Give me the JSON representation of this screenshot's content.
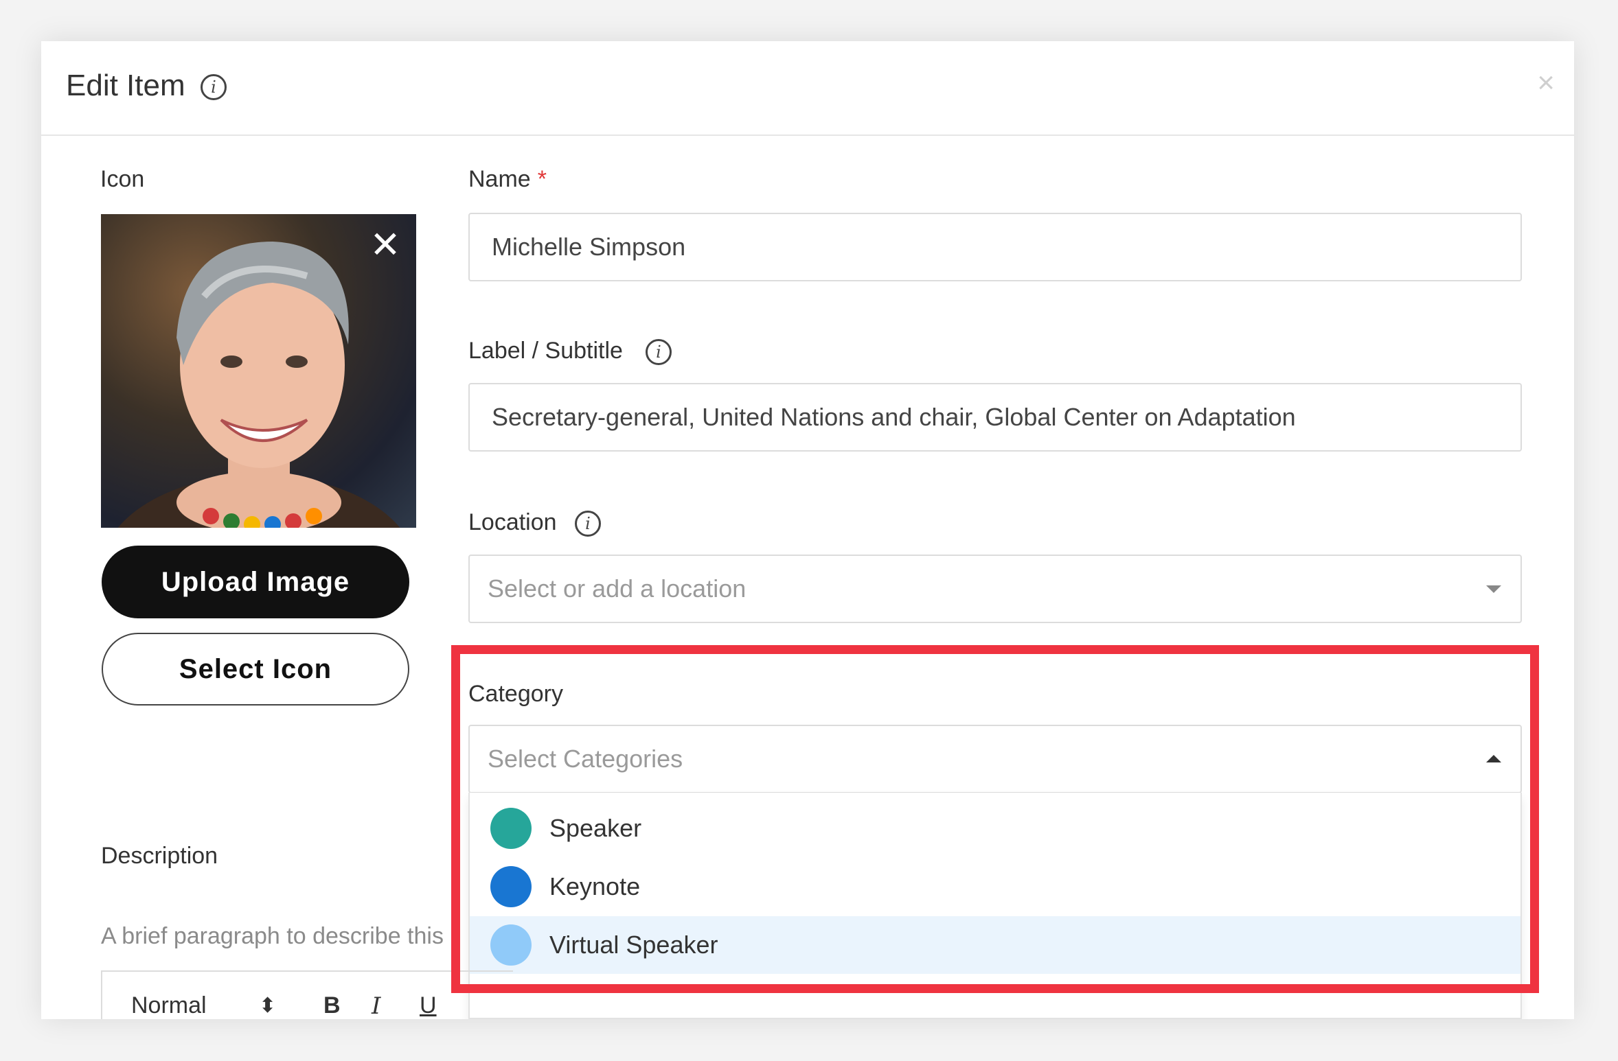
{
  "modal": {
    "title": "Edit Item",
    "close": "×"
  },
  "icon_section": {
    "label": "Icon",
    "photo_remove": "✕",
    "upload_button": "Upload Image",
    "select_button": "Select Icon"
  },
  "fields": {
    "name": {
      "label": "Name",
      "required_mark": "*",
      "value": "Michelle Simpson"
    },
    "subtitle": {
      "label": "Label / Subtitle",
      "value": "Secretary-general, United Nations and chair, Global Center on Adaptation"
    },
    "location": {
      "label": "Location",
      "placeholder": "Select or add a location"
    },
    "category": {
      "label": "Category",
      "placeholder": "Select Categories",
      "options": [
        {
          "label": "Speaker",
          "color": "#26a69a"
        },
        {
          "label": "Keynote",
          "color": "#1976d2"
        },
        {
          "label": "Virtual Speaker",
          "color": "#90caf9"
        }
      ]
    }
  },
  "description": {
    "label": "Description",
    "hint": "A brief paragraph to describe this i",
    "toolbar": {
      "format": "Normal",
      "format_arrows": "⬍",
      "bold": "B",
      "italic": "I",
      "underline": "U"
    }
  },
  "colors": {
    "highlight": "#ef3340",
    "active_option_bg": "#eaf4fd"
  }
}
